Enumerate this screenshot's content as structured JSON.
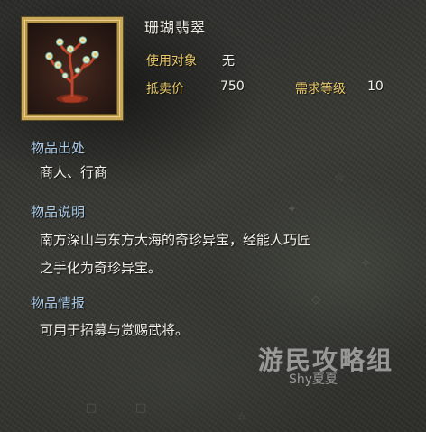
{
  "item": {
    "name": "珊瑚翡翠",
    "target_label": "使用对象",
    "target_value": "无",
    "price_label": "抵卖价",
    "price_value": "750",
    "level_label": "需求等级",
    "level_value": "10",
    "image_icon": "coral-jade-tree-icon"
  },
  "sections": {
    "origin_heading": "物品出处",
    "origin_text": "商人、行商",
    "desc_heading": "物品说明",
    "desc_line1": "南方深山与东方大海的奇珍异宝，经能人巧匠",
    "desc_line2": "之手化为奇珍异宝。",
    "info_heading": "物品情报",
    "info_text": "可用于招募与赏赐武将。"
  },
  "watermark": {
    "main": "游民攻略组",
    "sub": "Shy夏夏"
  },
  "colors": {
    "heading": "#a9c9e6",
    "label_gold": "#e9c86a",
    "frame_gold": "#c9a85a",
    "text": "#f3f1ea"
  }
}
